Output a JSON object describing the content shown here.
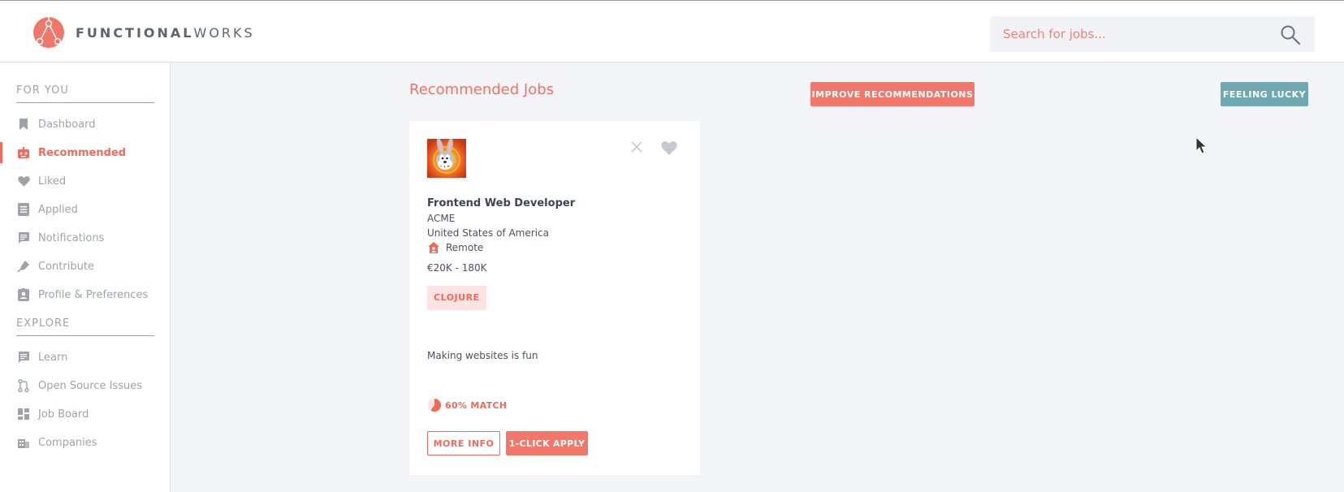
{
  "brand": {
    "name_bold": "FUNCTIONAL",
    "name_light": "WORKS",
    "accent": "#f1695b",
    "secondary": "#6ea8b0"
  },
  "search": {
    "placeholder": "Search for jobs...",
    "value": "",
    "icon": "search-icon"
  },
  "sidebar": {
    "sections": [
      {
        "title": "FOR YOU",
        "items": [
          {
            "label": "Dashboard",
            "icon": "bookmark-icon",
            "active": false
          },
          {
            "label": "Recommended",
            "icon": "robot-icon",
            "active": true
          },
          {
            "label": "Liked",
            "icon": "heart-icon",
            "active": false
          },
          {
            "label": "Applied",
            "icon": "document-icon",
            "active": false
          },
          {
            "label": "Notifications",
            "icon": "message-icon",
            "active": false
          },
          {
            "label": "Contribute",
            "icon": "pen-icon",
            "active": false
          },
          {
            "label": "Profile & Preferences",
            "icon": "badge-icon",
            "active": false
          }
        ]
      },
      {
        "title": "EXPLORE",
        "items": [
          {
            "label": "Learn",
            "icon": "message-icon",
            "active": false
          },
          {
            "label": "Open Source Issues",
            "icon": "pull-request-icon",
            "active": false
          },
          {
            "label": "Job Board",
            "icon": "dashboard-grid-icon",
            "active": false
          },
          {
            "label": "Companies",
            "icon": "building-icon",
            "active": false
          }
        ]
      }
    ]
  },
  "main": {
    "title": "Recommended Jobs",
    "improve_label": "IMPROVE RECOMMENDATIONS",
    "lucky_label": "FEELING LUCKY"
  },
  "job_card": {
    "title": "Frontend Web Developer",
    "company": "ACME",
    "location": "United States of America",
    "remote_label": "Remote",
    "salary": "€20K - 180K",
    "tag": "CLOJURE",
    "description": "Making websites is fun",
    "match_label": "60% MATCH",
    "match_percent": 60,
    "more_info_label": "MORE INFO",
    "apply_label": "1-CLICK APPLY",
    "avatar_icon": "rabbit-avatar-icon"
  }
}
